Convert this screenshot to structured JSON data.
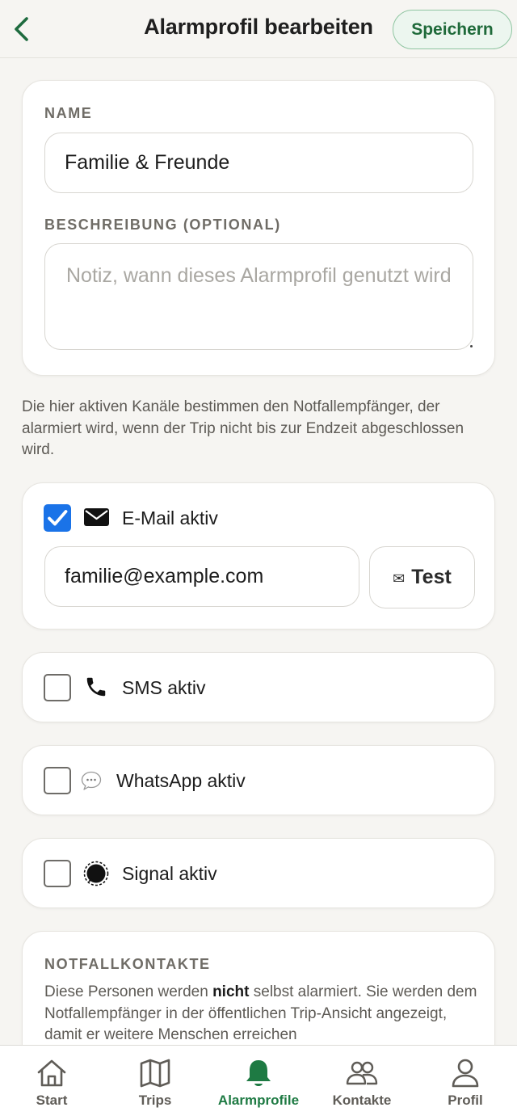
{
  "header": {
    "title": "Alarmprofil bearbeiten",
    "save_label": "Speichern"
  },
  "profile_form": {
    "name_label": "NAME",
    "name_value": "Familie & Freunde",
    "description_label": "BESCHREIBUNG (OPTIONAL)",
    "description_placeholder": "Notiz, wann dieses Alarmprofil genutzt wird"
  },
  "info_text": "Die hier aktiven Kanäle bestimmen den Notfallempfänger, der alarmiert wird, wenn der Trip nicht bis zur Endzeit abgeschlossen wird.",
  "channels": {
    "email": {
      "label": "E-Mail aktiv",
      "checked": true,
      "value": "familie@example.com",
      "test_label": "Test",
      "icon": "envelope-icon"
    },
    "sms": {
      "label": "SMS aktiv",
      "checked": false,
      "icon": "phone-icon"
    },
    "whatsapp": {
      "label": "WhatsApp aktiv",
      "checked": false,
      "icon": "speech-bubble-icon"
    },
    "signal": {
      "label": "Signal aktiv",
      "checked": false,
      "icon": "signal-bubble-icon"
    }
  },
  "emergency_contacts": {
    "title": "NOTFALLKONTAKTE",
    "text_before": "Diese Personen werden ",
    "text_bold": "nicht",
    "text_after": " selbst alarmiert. Sie werden dem Notfallempfänger in der öffentlichen Trip-Ansicht angezeigt, damit er weitere Menschen erreichen"
  },
  "nav": {
    "items": [
      {
        "label": "Start",
        "icon": "home-icon",
        "active": false
      },
      {
        "label": "Trips",
        "icon": "map-icon",
        "active": false
      },
      {
        "label": "Alarmprofile",
        "icon": "bell-icon",
        "active": true
      },
      {
        "label": "Kontakte",
        "icon": "people-icon",
        "active": false
      },
      {
        "label": "Profil",
        "icon": "user-icon",
        "active": false
      }
    ]
  },
  "colors": {
    "accent_green": "#1e7a43",
    "checkbox_blue": "#1a73e8",
    "background": "#f6f5f2"
  }
}
